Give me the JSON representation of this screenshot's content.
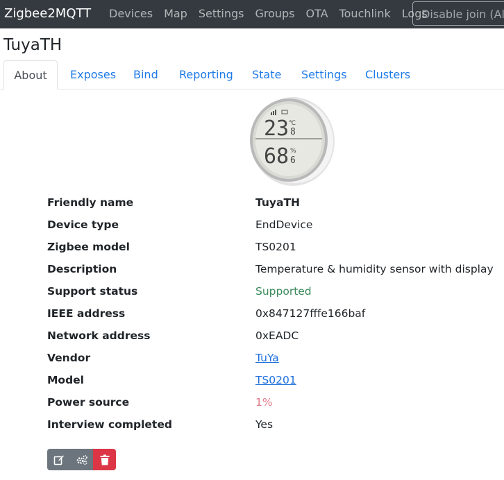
{
  "navbar": {
    "brand": "Zigbee2MQTT",
    "links": [
      "Devices",
      "Map",
      "Settings",
      "Groups",
      "OTA",
      "Touchlink",
      "Logs"
    ],
    "join_button": "Disable join (All)"
  },
  "page": {
    "title": "TuyaTH"
  },
  "tabs": [
    "About",
    "Exposes",
    "Bind",
    "Reporting",
    "State",
    "Settings",
    "Clusters"
  ],
  "device_image": {
    "temperature_int": "23",
    "temperature_dec": "8",
    "temp_unit": "℃",
    "humidity_int": "68",
    "humidity_dec": "6",
    "humidity_unit": "%"
  },
  "info": [
    {
      "key": "Friendly name",
      "value": "TuyaTH",
      "style": "bold"
    },
    {
      "key": "Device type",
      "value": "EndDevice",
      "style": ""
    },
    {
      "key": "Zigbee model",
      "value": "TS0201",
      "style": ""
    },
    {
      "key": "Description",
      "value": "Temperature & humidity sensor with display",
      "style": ""
    },
    {
      "key": "Support status",
      "value": "Supported",
      "style": "success"
    },
    {
      "key": "IEEE address",
      "value": "0x847127fffe166baf",
      "style": ""
    },
    {
      "key": "Network address",
      "value": "0xEADC",
      "style": ""
    },
    {
      "key": "Vendor",
      "value": "TuYa",
      "style": "link"
    },
    {
      "key": "Model",
      "value": "TS0201",
      "style": "link"
    },
    {
      "key": "Power source",
      "value": "1%",
      "style": "danger"
    },
    {
      "key": "Interview completed",
      "value": "Yes",
      "style": ""
    }
  ],
  "actions": [
    {
      "icon": "edit-icon"
    },
    {
      "icon": "cogs-icon"
    },
    {
      "icon": "trash-icon"
    }
  ],
  "colors": {
    "navbar": "#343a40",
    "link": "#1e7be8",
    "success": "#3a8a5a",
    "danger": "#dc3545"
  }
}
